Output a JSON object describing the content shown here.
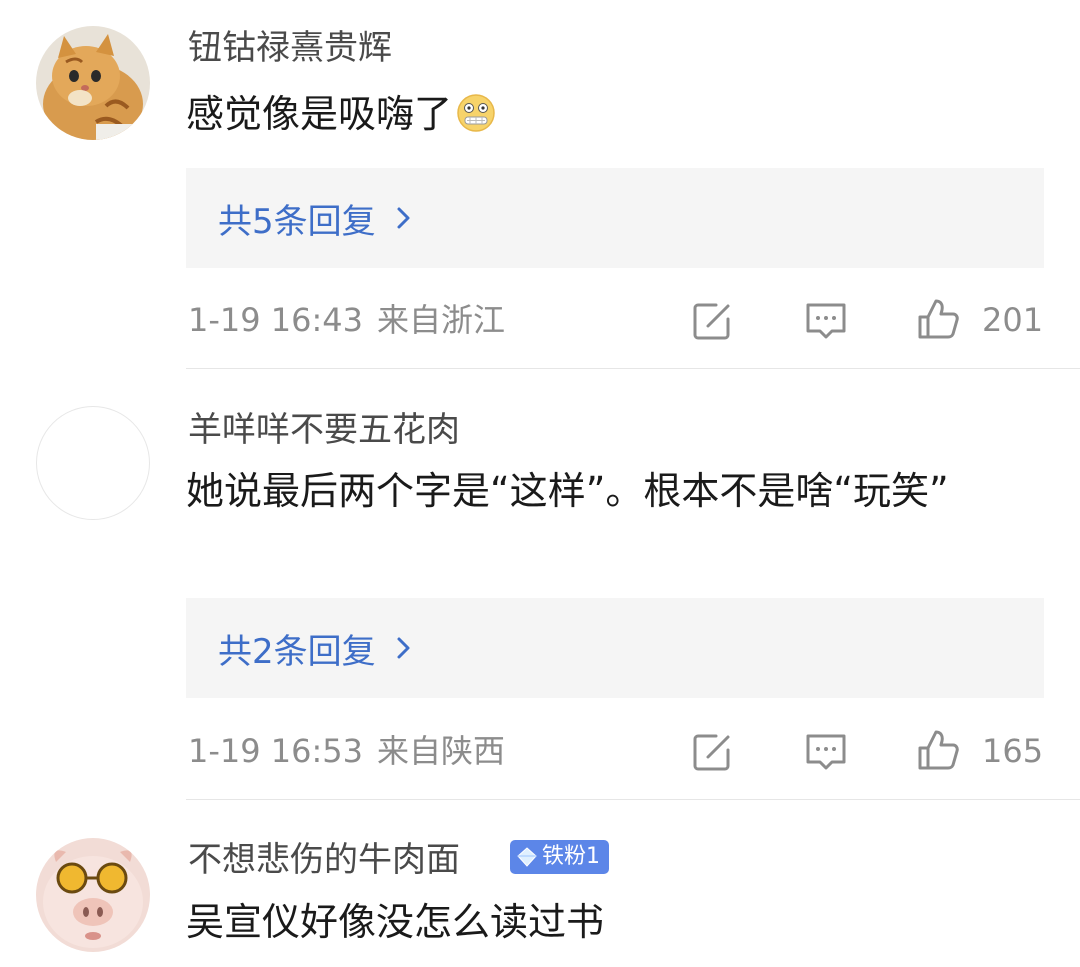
{
  "comments": [
    {
      "username": "钮钴禄熹贵辉",
      "text": "感觉像是吸嗨了",
      "avatar_icon": "cat-avatar",
      "inline_emoji": "zipper-mouth-emoji",
      "replies_label": "共5条回复",
      "time": "1-19 16:43",
      "location": "来自浙江",
      "likes": "201"
    },
    {
      "username": "羊咩咩不要五花肉",
      "text": "她说最后两个字是“这样”。根本不是啥“玩笑”",
      "avatar_icon": "blank-avatar",
      "replies_label": "共2条回复",
      "time": "1-19 16:53",
      "location": "来自陕西",
      "likes": "165"
    },
    {
      "username": "不想悲伤的牛肉面",
      "badge": "铁粉1",
      "badge_icon": "diamond-icon",
      "text": "吴宣仪好像没怎么读过书",
      "avatar_icon": "pig-with-sunglasses-avatar"
    }
  ],
  "colors": {
    "link_blue": "#3e6ec8",
    "meta_gray": "#8c8c8c",
    "reply_box_bg": "#f5f5f5",
    "badge_blue": "#5c86e8"
  }
}
